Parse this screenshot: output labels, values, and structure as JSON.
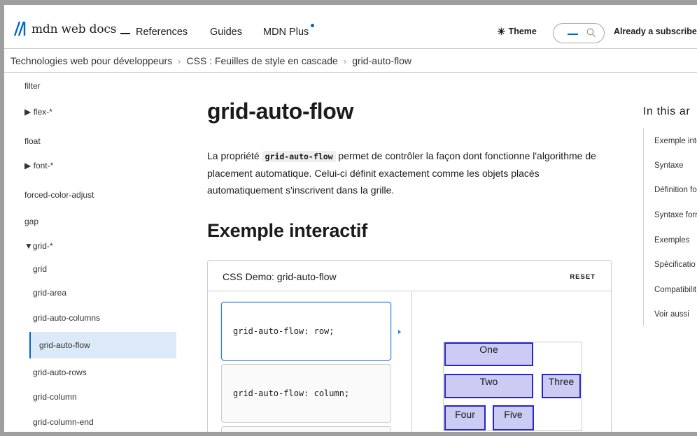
{
  "header": {
    "logo_text": "mdn web docs",
    "nav": [
      "References",
      "Guides",
      "MDN Plus"
    ],
    "theme_label": "Theme",
    "subscriber_label": "Already a subscriber",
    "colors": {
      "accent": "#0069c2",
      "logo": "#0069c2"
    }
  },
  "breadcrumb": [
    "Technologies web pour développeurs",
    "CSS : Feuilles de style en cascade",
    "grid-auto-flow"
  ],
  "sidebar": {
    "items": [
      "filter",
      "▶ flex-*",
      "float",
      "▶ font-*",
      "forced-color-adjust",
      "gap",
      "▼grid-*",
      "grid",
      "grid-area",
      "grid-auto-columns",
      "grid-auto-flow",
      "grid-auto-rows",
      "grid-column",
      "grid-column-end"
    ],
    "active": "grid-auto-flow"
  },
  "main": {
    "title": "grid-auto-flow",
    "intro_before": "La propriété ",
    "intro_code": "grid-auto-flow",
    "intro_after": " permet de contrôler la façon dont fonctionne l'algorithme de placement automatique. Celui-ci définit exactement comme les objets placés automatiquement s'inscrivent dans la grille.",
    "section_title": "Exemple interactif"
  },
  "demo": {
    "title": "CSS Demo: grid-auto-flow",
    "reset_label": "RESET",
    "options": [
      "grid-auto-flow: row;",
      "grid-auto-flow: column;"
    ],
    "selected_option": "grid-auto-flow: row;",
    "cells": [
      "One",
      "Two",
      "Three",
      "Four",
      "Five"
    ],
    "cell_colors": {
      "fill": "#cbcbf4",
      "border": "#2626c8"
    }
  },
  "toc": {
    "title": "In this ar",
    "items": [
      "Exemple inte",
      "Syntaxe",
      "Définition fo",
      "Syntaxe forr",
      "Exemples",
      "Spécificatio",
      "Compatibilit",
      "Voir aussi"
    ]
  }
}
